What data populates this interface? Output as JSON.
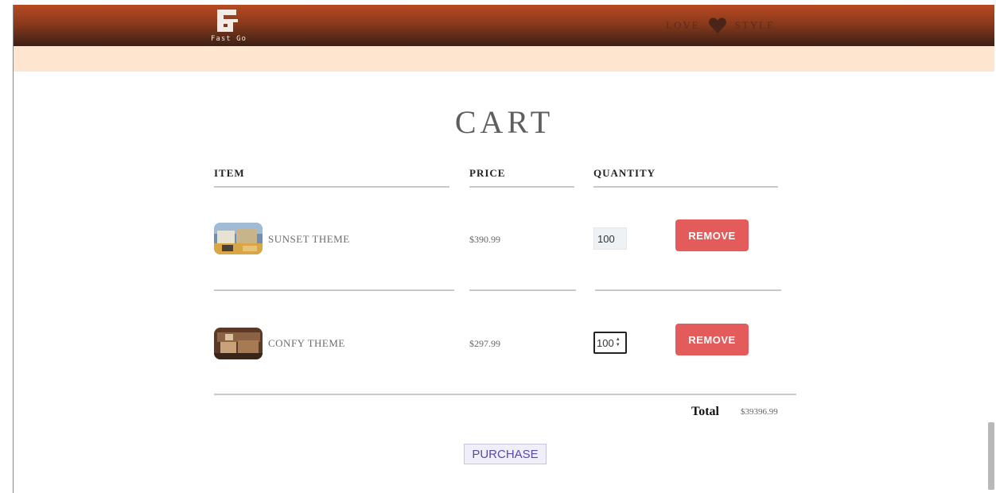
{
  "header": {
    "logo_text": "Fast Go",
    "slogan_left": "LOVE",
    "slogan_right": "STYLE",
    "icons": [
      "logo-mark",
      "heart-icon"
    ]
  },
  "cart": {
    "title": "CART",
    "columns": {
      "item": "ITEM",
      "price": "PRICE",
      "quantity": "QUANTITY"
    },
    "items": [
      {
        "name": "SUNSET THEME",
        "price": "$390.99",
        "quantity": "100",
        "remove_label": "REMOVE",
        "thumb": "sunset-theme-thumbnail"
      },
      {
        "name": "CONFY THEME",
        "price": "$297.99",
        "quantity": "100",
        "remove_label": "REMOVE",
        "thumb": "confy-theme-thumbnail"
      }
    ],
    "total_label": "Total",
    "total_value": "$39396.99",
    "purchase_label": "PURCHASE"
  },
  "colors": {
    "header_top": "#b84a22",
    "header_bottom": "#3b2016",
    "subbar": "#fde5cf",
    "remove_button": "#e35b5b",
    "purchase_text": "#5a4aa0"
  }
}
